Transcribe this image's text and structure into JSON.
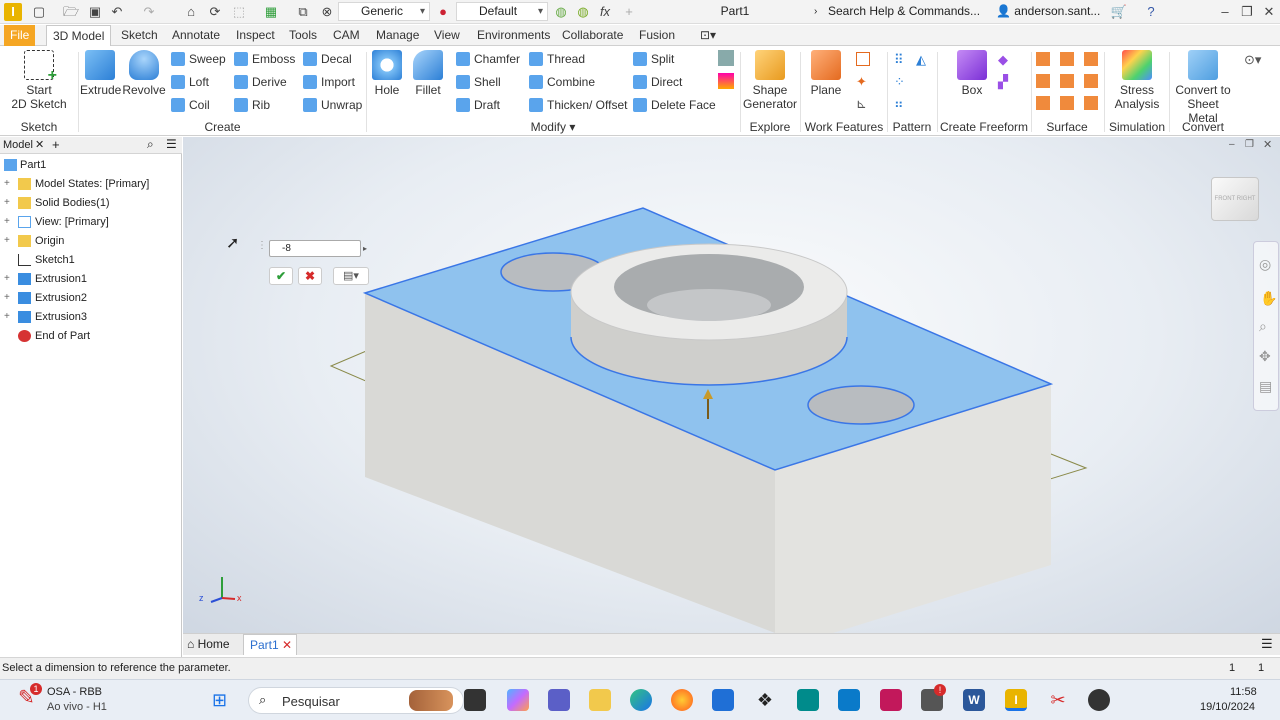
{
  "titlebar": {
    "material": "Generic",
    "appearance": "Default",
    "doc_title": "Part1",
    "search_placeholder": "Search Help & Commands...",
    "user": "anderson.sant..."
  },
  "tabs": [
    "File",
    "3D Model",
    "Sketch",
    "Annotate",
    "Inspect",
    "Tools",
    "CAM",
    "Manage",
    "View",
    "Environments",
    "Collaborate",
    "Fusion"
  ],
  "ribbon": {
    "sketch": {
      "start_sketch": [
        "Start",
        "2D Sketch"
      ],
      "panel": "Sketch"
    },
    "create": {
      "extrude": "Extrude",
      "revolve": "Revolve",
      "sweep": "Sweep",
      "loft": "Loft",
      "coil": "Coil",
      "emboss": "Emboss",
      "derive": "Derive",
      "rib": "Rib",
      "decal": "Decal",
      "import": "Import",
      "unwrap": "Unwrap",
      "panel": "Create"
    },
    "modify": {
      "hole": "Hole",
      "fillet": "Fillet",
      "chamfer": "Chamfer",
      "shell": "Shell",
      "draft": "Draft",
      "thread": "Thread",
      "combine": "Combine",
      "thicken": "Thicken/ Offset",
      "split": "Split",
      "direct": "Direct",
      "delete_face": "Delete Face",
      "panel": "Modify"
    },
    "explore": {
      "shape_generator": [
        "Shape",
        "Generator"
      ],
      "panel": "Explore"
    },
    "work_features": {
      "plane": "Plane",
      "panel": "Work Features"
    },
    "pattern": {
      "panel": "Pattern"
    },
    "freeform": {
      "box": "Box",
      "panel": "Create Freeform"
    },
    "surface": {
      "panel": "Surface"
    },
    "simulation": {
      "stress": [
        "Stress",
        "Analysis"
      ],
      "panel": "Simulation"
    },
    "convert": {
      "sheet_metal": [
        "Convert to",
        "Sheet Metal"
      ],
      "panel": "Convert"
    }
  },
  "browser": {
    "tab": "Model",
    "root": "Part1",
    "nodes": [
      "Model States: [Primary]",
      "Solid Bodies(1)",
      "View: [Primary]",
      "Origin",
      "Sketch1",
      "Extrusion1",
      "Extrusion2",
      "Extrusion3",
      "End of Part"
    ]
  },
  "viewport": {
    "mini_input_value": "-8",
    "viewcube": [
      "FRONT",
      "RIGHT"
    ],
    "triad": {
      "z": "z",
      "x": "x"
    }
  },
  "doc_tabs": {
    "home": "Home",
    "part": "Part1"
  },
  "status": {
    "message": "Select a dimension to reference the parameter.",
    "count1": "1",
    "count2": "1"
  },
  "taskbar": {
    "stream_title": "OSA - RBB",
    "stream_sub": "Ao vivo - H1",
    "search": "Pesquisar",
    "time": "11:58",
    "date": "19/10/2024"
  },
  "colors": {
    "accent": "#f5a623",
    "selected_face": "#8fc2ee",
    "edge": "#3a76e6"
  }
}
